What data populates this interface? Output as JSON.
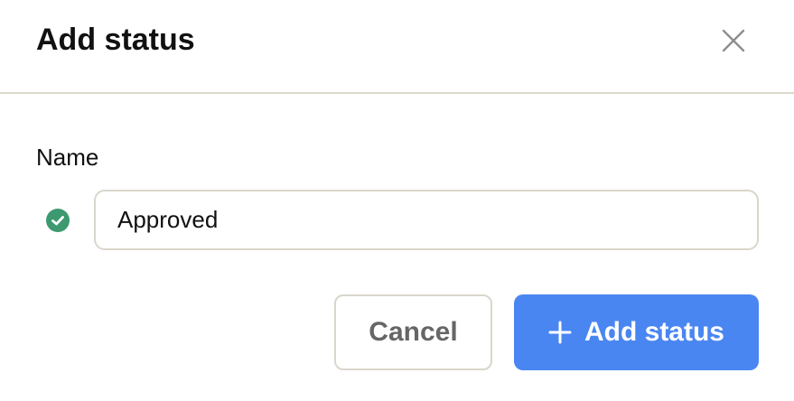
{
  "dialog": {
    "title": "Add status",
    "close_icon": "close-icon"
  },
  "form": {
    "name_label": "Name",
    "name_value": "Approved",
    "status_icon": "check-circle-icon",
    "status_color": "#3d9970"
  },
  "actions": {
    "cancel_label": "Cancel",
    "add_label": "Add status",
    "add_icon": "plus-icon",
    "accent_color": "#4a86f2"
  }
}
